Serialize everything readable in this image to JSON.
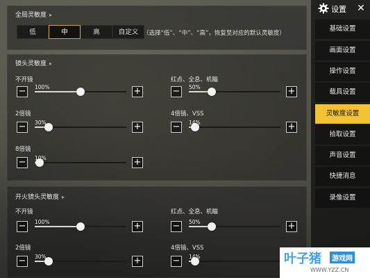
{
  "global": {
    "title": "全局灵敏度",
    "options": [
      "低",
      "中",
      "高",
      "自定义"
    ],
    "selected": 1,
    "hint": "（选择“低”、“中”、“高”，恢复至对应的默认灵敏度）"
  },
  "scope": {
    "title": "镜头灵敏度",
    "sliders": [
      {
        "label": "不开镜",
        "value_text": "100%",
        "fraction": 0.5
      },
      {
        "label": "红点、全息、机瞄",
        "value_text": "50%",
        "fraction": 0.25
      },
      {
        "label": "2倍镜",
        "value_text": "30%",
        "fraction": 0.155
      },
      {
        "label": "4倍镜、VSS",
        "value_text": "14%",
        "fraction": 0.065
      },
      {
        "label": "8倍镜",
        "value_text": "10%",
        "fraction": 0.05
      }
    ]
  },
  "fire": {
    "title": "开火镜头灵敏度",
    "sliders": [
      {
        "label": "不开镜",
        "value_text": "100%",
        "fraction": 0.5
      },
      {
        "label": "红点、全息、机瞄",
        "value_text": "50%",
        "fraction": 0.25
      },
      {
        "label": "2倍镜",
        "value_text": "30%",
        "fraction": 0.155
      },
      {
        "label": "4倍镜、VSS",
        "value_text": "14%",
        "fraction": 0.065
      }
    ]
  },
  "controls": {
    "minus": "−",
    "plus": "+"
  },
  "sidebar": {
    "title": "设置",
    "close": "✕",
    "items": [
      "基础设置",
      "画面设置",
      "操作设置",
      "载具设置",
      "灵敏度设置",
      "拾取设置",
      "声音设置",
      "快捷消息",
      "录像设置"
    ],
    "active": 4
  },
  "watermark": {
    "brand": "叶子猪",
    "tag": "游戏网",
    "url": "WWW.YZZ.CN"
  },
  "icons": {
    "gear": "gear-icon",
    "close": "close-icon",
    "arrow": "chevron-right-icon"
  }
}
